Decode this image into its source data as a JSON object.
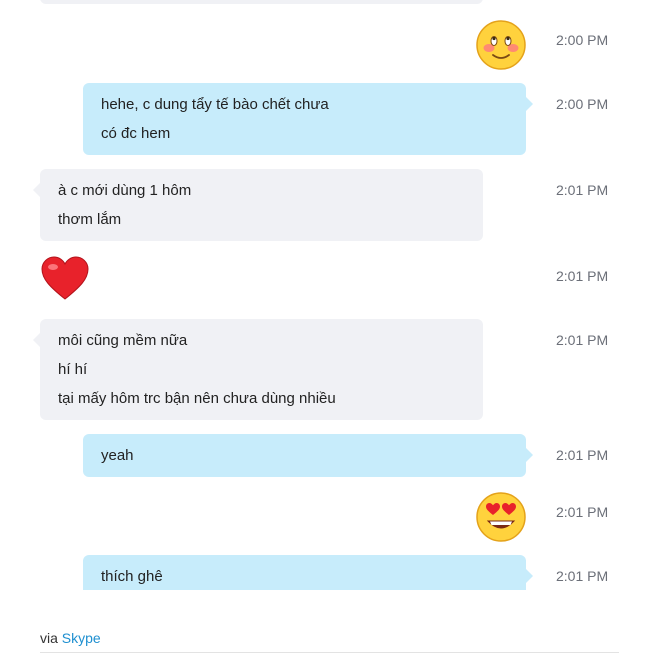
{
  "messages": [
    {
      "type": "emoji",
      "emoji": "blushing-smile",
      "time": "2:00 PM"
    },
    {
      "type": "outgoing",
      "lines": [
        "hehe, c dung tẩy tế bào chết chưa",
        "có đc hem"
      ],
      "time": "2:00 PM"
    },
    {
      "type": "incoming",
      "lines": [
        "à c mới dùng 1 hôm",
        "thơm lắm"
      ],
      "time": "2:01 PM"
    },
    {
      "type": "emoji",
      "emoji": "red-heart",
      "time": "2:01 PM"
    },
    {
      "type": "incoming",
      "lines": [
        "môi cũng mềm nữa",
        "hí hí",
        "tại mấy hôm trc bận nên chưa dùng nhiều"
      ],
      "time": "2:01 PM"
    },
    {
      "type": "outgoing",
      "lines": [
        "yeah"
      ],
      "time": "2:01 PM"
    },
    {
      "type": "emoji",
      "emoji": "heart-eyes-smile",
      "time": "2:01 PM"
    },
    {
      "type": "outgoing",
      "lines": [
        "thích ghê"
      ],
      "time": "2:01 PM"
    }
  ],
  "footer": {
    "prefix": "via",
    "link": "Skype"
  },
  "colors": {
    "outgoing_bubble": "#c7ecfb",
    "incoming_bubble": "#f0f1f5",
    "link": "#1e8fd0",
    "timestamp": "#6b6f78"
  }
}
